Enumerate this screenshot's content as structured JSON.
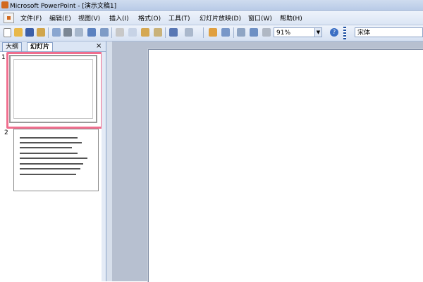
{
  "window": {
    "title": "Microsoft PowerPoint - [演示文稿1]"
  },
  "menubar": {
    "items": [
      {
        "label": "文件(F)"
      },
      {
        "label": "编辑(E)"
      },
      {
        "label": "视图(V)"
      },
      {
        "label": "插入(I)"
      },
      {
        "label": "格式(O)"
      },
      {
        "label": "工具(T)"
      },
      {
        "label": "幻灯片放映(D)"
      },
      {
        "label": "窗口(W)"
      },
      {
        "label": "帮助(H)"
      }
    ]
  },
  "toolbar": {
    "zoom_value": "91%",
    "font_name": "宋体",
    "icons": [
      "new-icon",
      "open-icon",
      "save-icon",
      "permission-icon",
      "email-icon",
      "print-icon",
      "print-preview-icon",
      "spelling-icon",
      "research-icon",
      "cut-icon",
      "copy-icon",
      "paste-icon",
      "format-painter-icon",
      "undo-icon",
      "redo-icon",
      "chart-icon",
      "table-icon",
      "expand-icon",
      "grid-icon",
      "color-grayscale-icon"
    ]
  },
  "left_pane": {
    "tabs": [
      {
        "label": "大纲"
      },
      {
        "label": "幻灯片"
      }
    ],
    "close": "×",
    "slides": [
      {
        "number": "1",
        "selected": true
      },
      {
        "number": "2",
        "selected": false
      }
    ]
  },
  "colors": {
    "selection_border": "#f06e8e",
    "workspace_bg": "#b7c0d0",
    "chrome_blue": "#dbe5f4"
  }
}
